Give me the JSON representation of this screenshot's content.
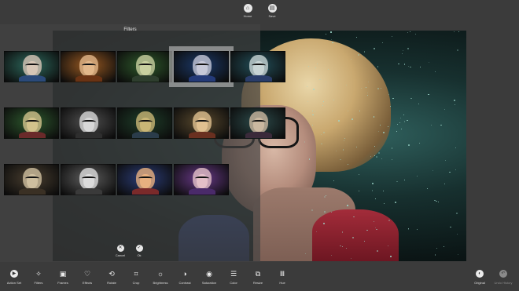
{
  "topbar": {
    "home_label": "Home",
    "save_label": "Save"
  },
  "filters": {
    "title": "Filters",
    "cancel_label": "Cancel",
    "ok_label": "Ok",
    "thumbnails": [
      {
        "row": 0,
        "col": 0,
        "tint": "#2e6a5e",
        "skin": "#d7c6b6",
        "body": "#2b4a7a"
      },
      {
        "row": 0,
        "col": 1,
        "tint": "#9a5a22",
        "skin": "#e2b78a",
        "body": "#6a3314"
      },
      {
        "row": 0,
        "col": 2,
        "tint": "#2f5a2c",
        "skin": "#c9d0a0",
        "body": "#2e3e2e"
      },
      {
        "row": 0,
        "col": 3,
        "tint": "#1c3a6a",
        "skin": "#c6c8d8",
        "body": "#243a78",
        "selected": true
      },
      {
        "row": 0,
        "col": 4,
        "tint": "#234f5a",
        "skin": "#c8d4d4",
        "body": "#2a3d6a"
      },
      {
        "row": 1,
        "col": 0,
        "tint": "#2e5a2e",
        "skin": "#d2c28c",
        "body": "#6a2a2a"
      },
      {
        "row": 1,
        "col": 1,
        "tint": "#505050",
        "skin": "#d8d8d8",
        "body": "#2e2e2e"
      },
      {
        "row": 1,
        "col": 2,
        "tint": "#1f3f2a",
        "skin": "#c9b676",
        "body": "#2a3c4a"
      },
      {
        "row": 1,
        "col": 3,
        "tint": "#5a4a2e",
        "skin": "#e0c090",
        "body": "#6a3020"
      },
      {
        "row": 1,
        "col": 4,
        "tint": "#2c4a4a",
        "skin": "#cab8a0",
        "body": "#3a2a3a"
      },
      {
        "row": 2,
        "col": 0,
        "tint": "#4a3f30",
        "skin": "#cfbf9f",
        "body": "#3a3024"
      },
      {
        "row": 2,
        "col": 1,
        "tint": "#5e5e5e",
        "skin": "#dcdcdc",
        "body": "#3a3a3a"
      },
      {
        "row": 2,
        "col": 2,
        "tint": "#2c3e7a",
        "skin": "#e8b080",
        "body": "#7a2a2a"
      },
      {
        "row": 2,
        "col": 3,
        "tint": "#6a3a8a",
        "skin": "#e4c0c8",
        "body": "#4a2a6a"
      }
    ]
  },
  "toolbar": {
    "tools": [
      {
        "name": "action-set",
        "label": "Action Set",
        "icon": "▶",
        "round": true
      },
      {
        "name": "filters",
        "label": "Filters",
        "icon": "✧"
      },
      {
        "name": "frames",
        "label": "Frames",
        "icon": "▣"
      },
      {
        "name": "effects",
        "label": "Effects",
        "icon": "♡"
      },
      {
        "name": "rotate",
        "label": "Rotate",
        "icon": "⟲"
      },
      {
        "name": "crop",
        "label": "Crop",
        "icon": "⌗"
      },
      {
        "name": "brightness",
        "label": "Brightness",
        "icon": "☼"
      },
      {
        "name": "contrast",
        "label": "Contrast",
        "icon": "◑"
      },
      {
        "name": "saturation",
        "label": "Saturation",
        "icon": "◉"
      },
      {
        "name": "color",
        "label": "Color",
        "icon": "☰"
      },
      {
        "name": "resize",
        "label": "Resize",
        "icon": "⧉"
      },
      {
        "name": "hue",
        "label": "Hue",
        "icon": "Ⅲ"
      },
      {
        "name": "original",
        "label": "Original",
        "icon": "◐",
        "round": true
      },
      {
        "name": "undo-history",
        "label": "Undo History",
        "icon": "↶",
        "round": true,
        "disabled": true
      }
    ]
  }
}
